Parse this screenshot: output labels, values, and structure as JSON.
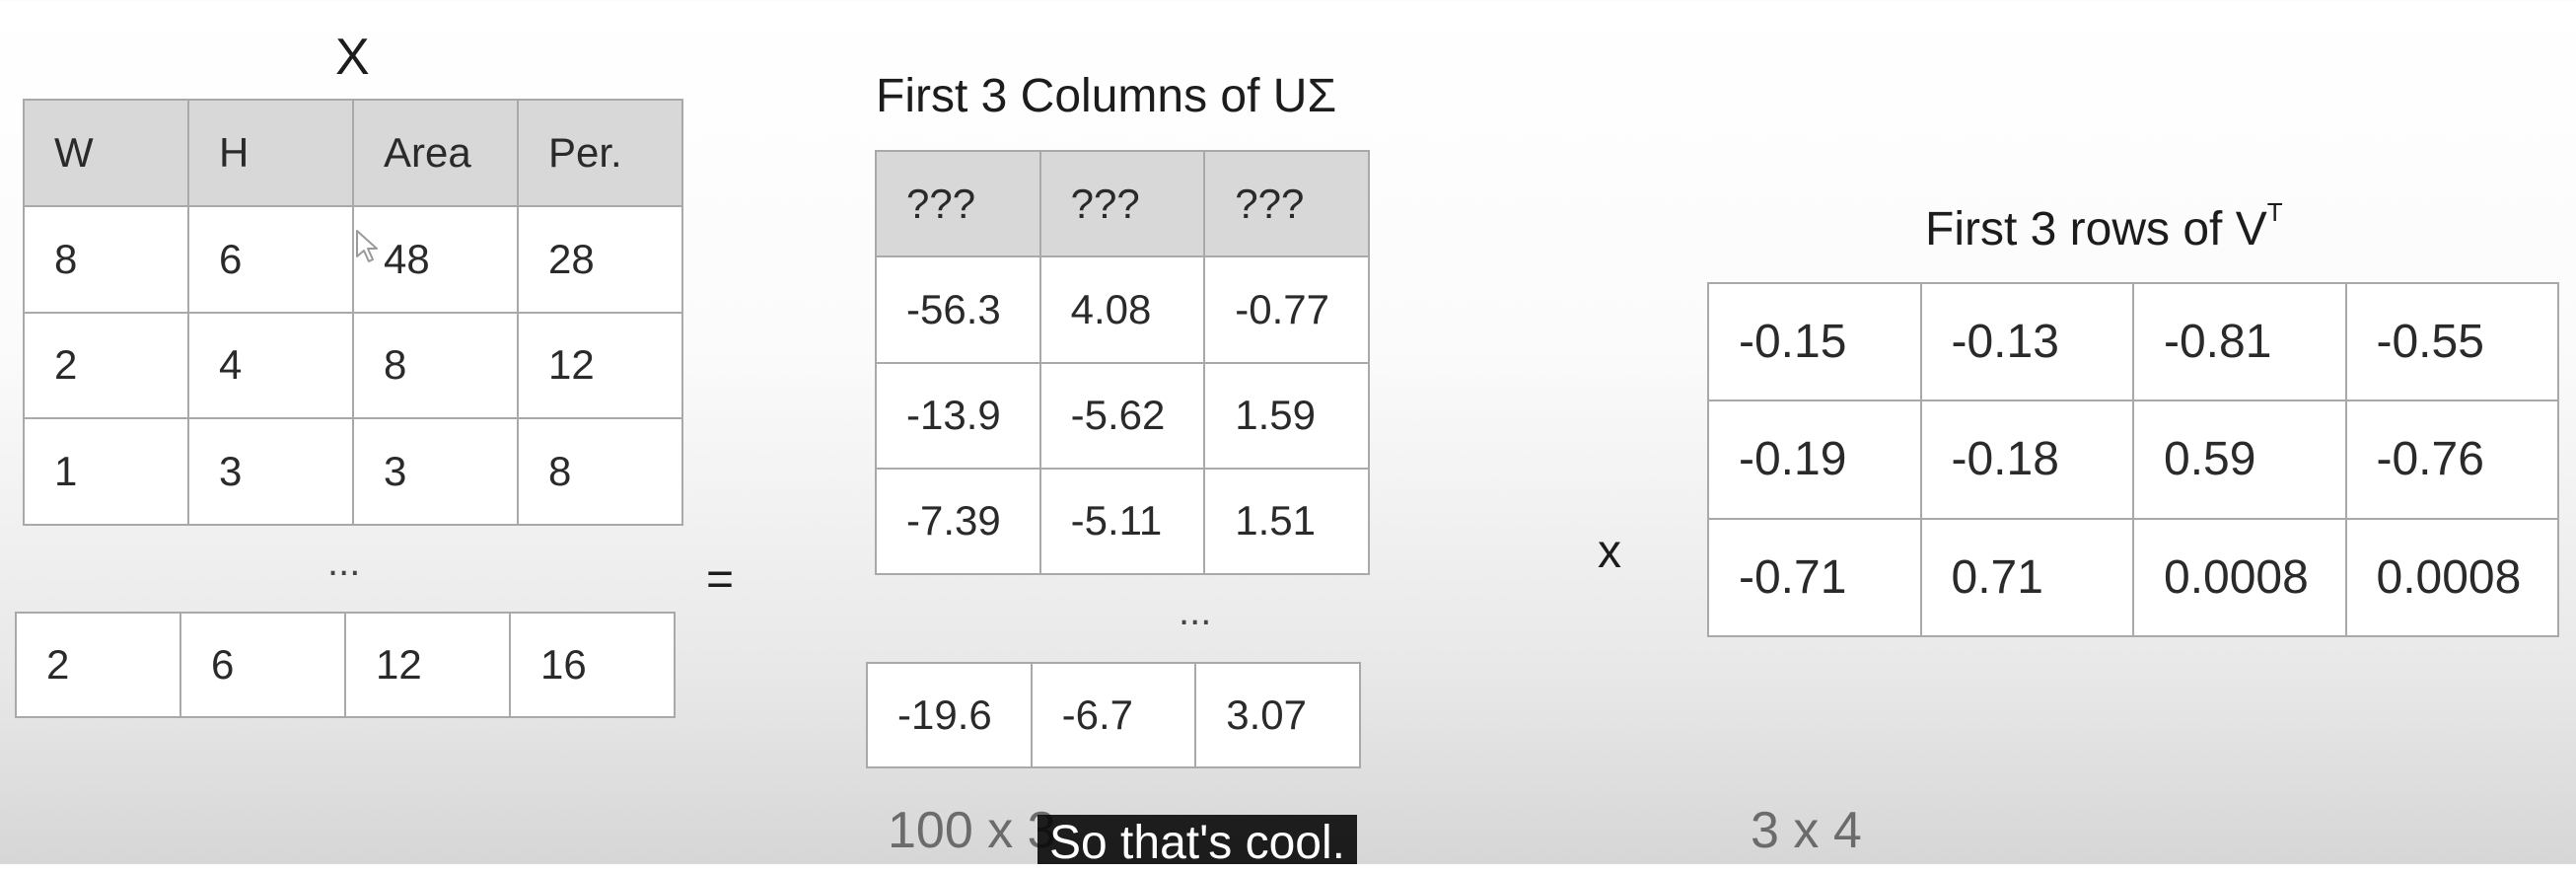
{
  "matrix_x": {
    "title": "X",
    "headers": [
      "W",
      "H",
      "Area",
      "Per."
    ],
    "rows": [
      [
        "8",
        "6",
        "48",
        "28"
      ],
      [
        "2",
        "4",
        "8",
        "12"
      ],
      [
        "1",
        "3",
        "3",
        "8"
      ]
    ],
    "ellipsis": "...",
    "last_row": [
      "2",
      "6",
      "12",
      "16"
    ]
  },
  "equals_sign": "=",
  "matrix_u_sigma": {
    "title": "First 3 Columns of UΣ",
    "headers": [
      "???",
      "???",
      "???"
    ],
    "rows": [
      [
        "-56.3",
        "4.08",
        "-0.77"
      ],
      [
        "-13.9",
        "-5.62",
        "1.59"
      ],
      [
        "-7.39",
        "-5.11",
        "1.51"
      ]
    ],
    "ellipsis": "...",
    "last_row": [
      "-19.6",
      "-6.7",
      "3.07"
    ],
    "dimensions": "100 x 3"
  },
  "times_sign": "x",
  "matrix_vt": {
    "title": "First 3 rows of V",
    "title_superscript": "T",
    "rows": [
      [
        "-0.15",
        "-0.13",
        "-0.81",
        "-0.55"
      ],
      [
        "-0.19",
        "-0.18",
        "0.59",
        "-0.76"
      ],
      [
        "-0.71",
        "0.71",
        "0.0008",
        "0.0008"
      ]
    ],
    "dimensions": "3 x 4"
  },
  "caption": "So that's cool."
}
